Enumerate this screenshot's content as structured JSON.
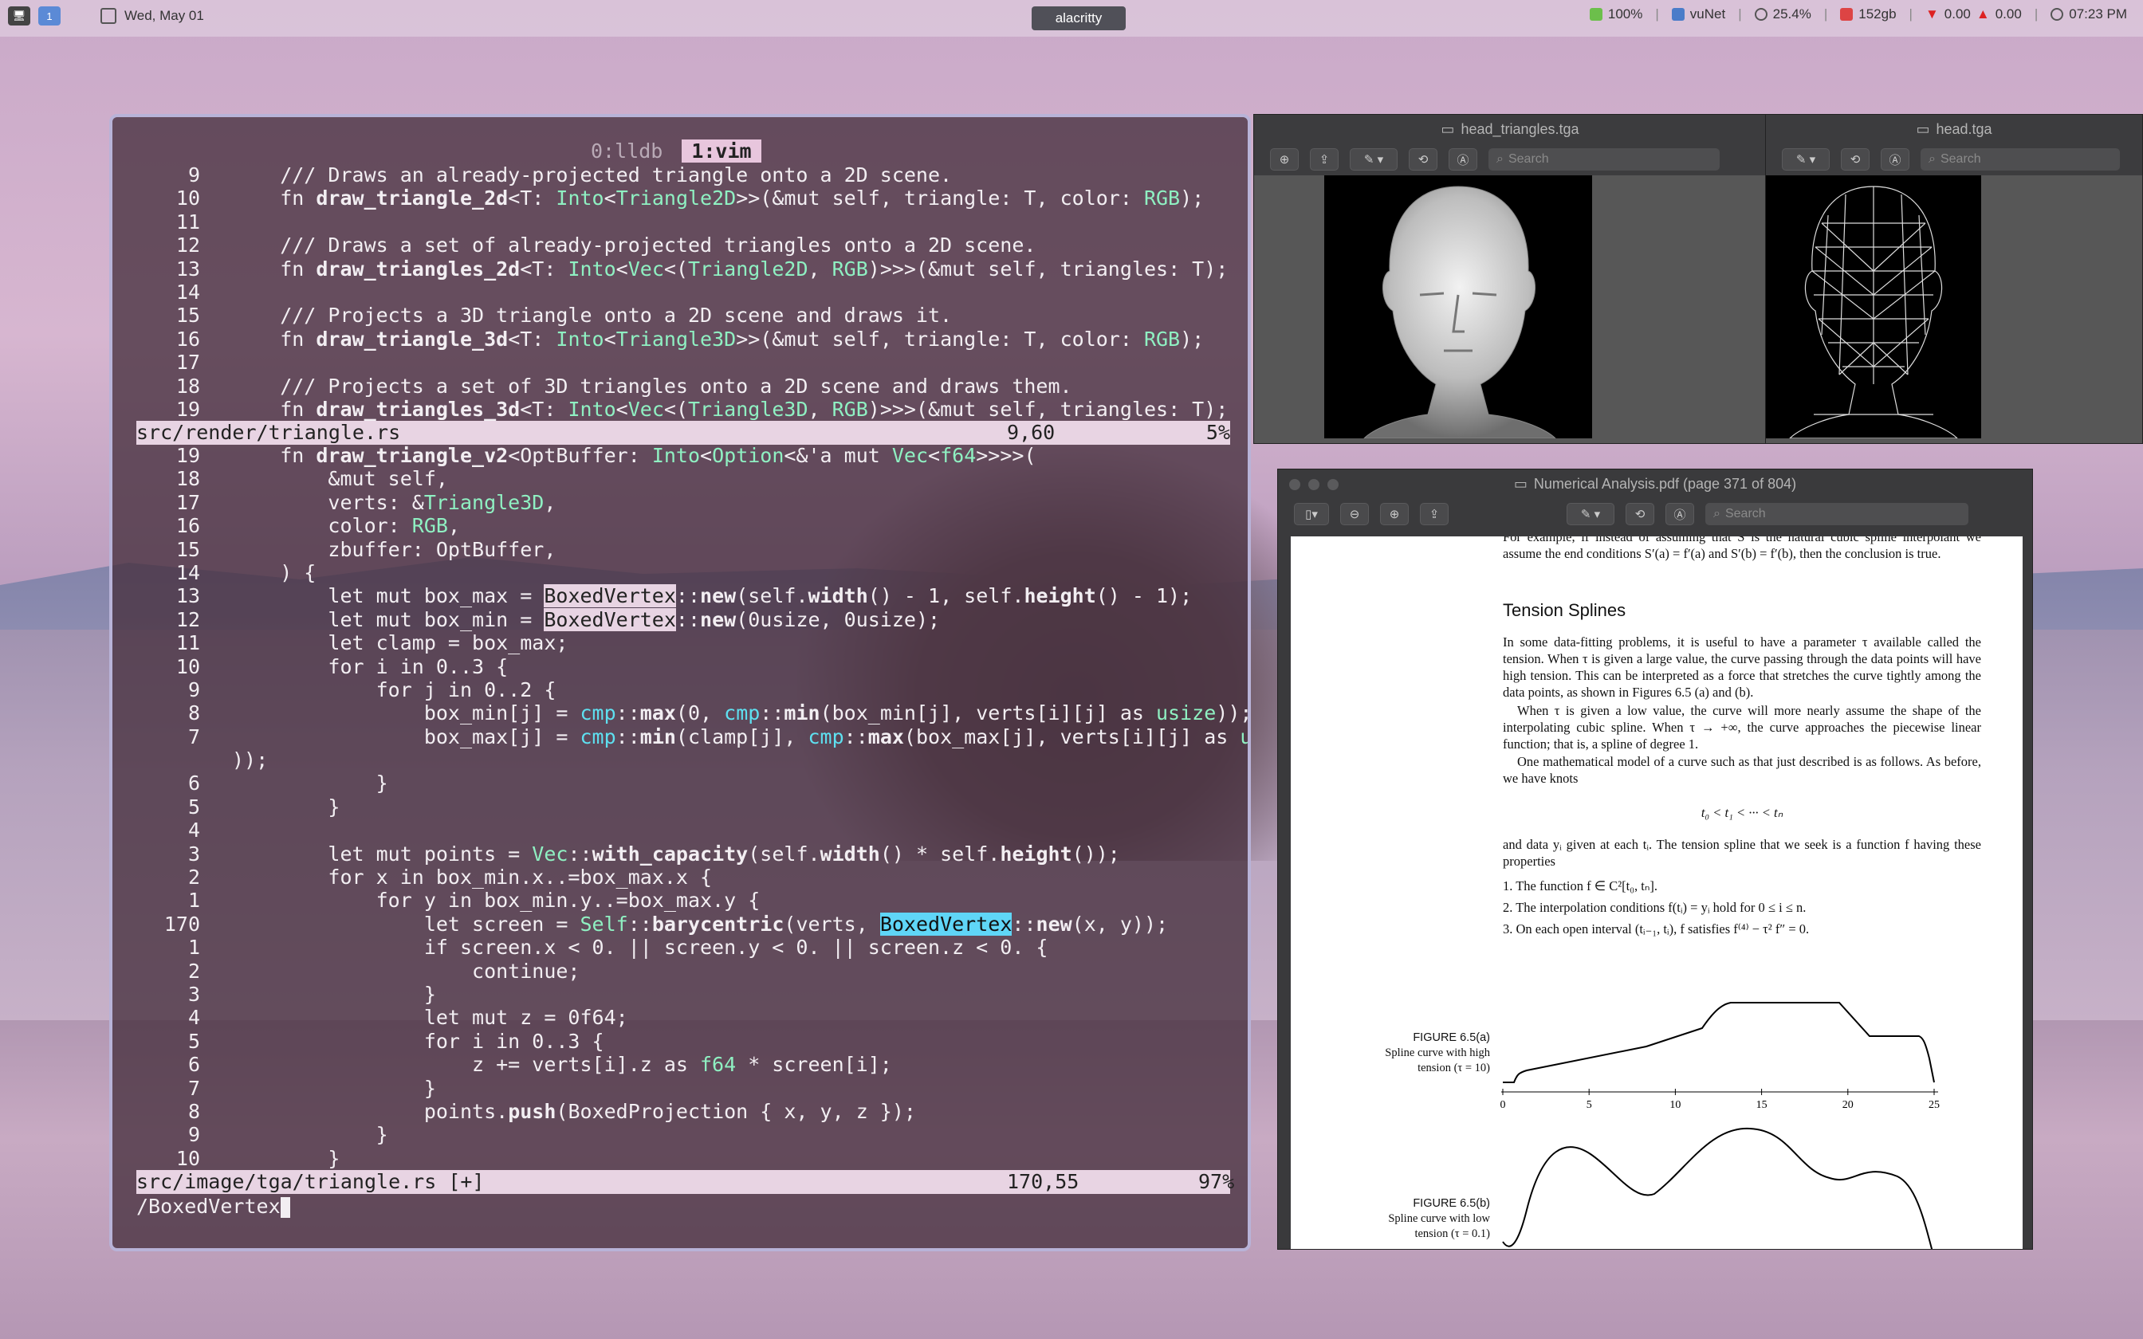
{
  "menubar": {
    "workspaces": [
      "🖥",
      "1"
    ],
    "date": "Wed, May 01",
    "active_app": "alacritty",
    "battery": "100%",
    "network": "vuNet",
    "cpu": "25.4%",
    "memory": "152gb",
    "net_down": "0.00",
    "net_up": "0.00",
    "time": "07:23 PM"
  },
  "terminal": {
    "tabs": [
      "0:lldb",
      "1:vim"
    ],
    "top_pane": {
      "lines": [
        {
          "n": "9",
          "t": "    /// Draws an already-projected triangle onto a 2D scene."
        },
        {
          "n": "10",
          "t": "    fn draw_triangle_2d<T: Into<Triangle2D>>(&mut self, triangle: T, color: RGB);"
        },
        {
          "n": "11",
          "t": ""
        },
        {
          "n": "12",
          "t": "    /// Draws a set of already-projected triangles onto a 2D scene."
        },
        {
          "n": "13",
          "t": "    fn draw_triangles_2d<T: Into<Vec<(Triangle2D, RGB)>>>(&mut self, triangles: T);"
        },
        {
          "n": "14",
          "t": ""
        },
        {
          "n": "15",
          "t": "    /// Projects a 3D triangle onto a 2D scene and draws it."
        },
        {
          "n": "16",
          "t": "    fn draw_triangle_3d<T: Into<Triangle3D>>(&mut self, triangle: T, color: RGB);"
        },
        {
          "n": "17",
          "t": ""
        },
        {
          "n": "18",
          "t": "    /// Projects a set of 3D triangles onto a 2D scene and draws them."
        },
        {
          "n": "19",
          "t": "    fn draw_triangles_3d<T: Into<Vec<(Triangle3D, RGB)>>>(&mut self, triangles: T);"
        }
      ],
      "status_file": "src/render/triangle.rs",
      "status_pos": "9,60",
      "status_pct": "5%"
    },
    "bottom_pane": {
      "lines": [
        {
          "n": "19",
          "t": "    fn draw_triangle_v2<OptBuffer: Into<Option<&'a mut Vec<f64>>>>("
        },
        {
          "n": "18",
          "t": "        &mut self,"
        },
        {
          "n": "17",
          "t": "        verts: &Triangle3D,"
        },
        {
          "n": "16",
          "t": "        color: RGB,"
        },
        {
          "n": "15",
          "t": "        zbuffer: OptBuffer,"
        },
        {
          "n": "14",
          "t": "    ) {"
        },
        {
          "n": "13",
          "t": "        let mut box_max = BoxedVertex::new(self.width() - 1, self.height() - 1);"
        },
        {
          "n": "12",
          "t": "        let mut box_min = BoxedVertex::new(0usize, 0usize);"
        },
        {
          "n": "11",
          "t": "        let clamp = box_max;"
        },
        {
          "n": "10",
          "t": "        for i in 0..3 {"
        },
        {
          "n": "9",
          "t": "            for j in 0..2 {"
        },
        {
          "n": "8",
          "t": "                box_min[j] = cmp::max(0, cmp::min(box_min[j], verts[i][j] as usize));"
        },
        {
          "n": "7",
          "t": "                box_max[j] = cmp::min(clamp[j], cmp::max(box_max[j], verts[i][j] as usize"
        },
        {
          "n": "",
          "t": "));"
        },
        {
          "n": "6",
          "t": "            }"
        },
        {
          "n": "5",
          "t": "        }"
        },
        {
          "n": "4",
          "t": ""
        },
        {
          "n": "3",
          "t": "        let mut points = Vec::with_capacity(self.width() * self.height());"
        },
        {
          "n": "2",
          "t": "        for x in box_min.x..=box_max.x {"
        },
        {
          "n": "1",
          "t": "            for y in box_min.y..=box_max.y {"
        },
        {
          "n": "170",
          "t": "                let screen = Self::barycentric(verts, BoxedVertex::new(x, y));"
        },
        {
          "n": "1",
          "t": "                if screen.x < 0. || screen.y < 0. || screen.z < 0. {"
        },
        {
          "n": "2",
          "t": "                    continue;"
        },
        {
          "n": "3",
          "t": "                }"
        },
        {
          "n": "4",
          "t": "                let mut z = 0f64;"
        },
        {
          "n": "5",
          "t": "                for i in 0..3 {"
        },
        {
          "n": "6",
          "t": "                    z += verts[i].z as f64 * screen[i];"
        },
        {
          "n": "7",
          "t": "                }"
        },
        {
          "n": "8",
          "t": "                points.push(BoxedProjection { x, y, z });"
        },
        {
          "n": "9",
          "t": "            }"
        },
        {
          "n": "10",
          "t": "        }"
        }
      ],
      "status_file": "src/image/tga/triangle.rs [+]",
      "status_pos": "170,55",
      "status_pct": "97%"
    },
    "command_line": "/BoxedVertex"
  },
  "preview1": {
    "title": "head_triangles.tga",
    "search_placeholder": "Search"
  },
  "preview2": {
    "title": "head.tga",
    "search_placeholder": "Search"
  },
  "pdf": {
    "title": "Numerical Analysis.pdf (page 371 of 804)",
    "search_placeholder": "Search",
    "intro": "For example, if instead of assuming that S is the natural cubic spline interpolant we assume the end conditions S′(a) = f′(a) and S′(b) = f′(b), then the conclusion is true.",
    "heading": "Tension Splines",
    "p1": "In some data-fitting problems, it is useful to have a parameter τ available called the tension. When τ is given a large value, the curve passing through the data points will have high tension. This can be interpreted as a force that stretches the curve tightly among the data points, as shown in Figures 6.5 (a) and (b).",
    "p2": "When τ is given a low value, the curve will more nearly assume the shape of the interpolating cubic spline. When τ → +∞, the curve approaches the piecewise linear function; that is, a spline of degree 1.",
    "p3": "One mathematical model of a curve such as that just described is as follows. As before, we have knots",
    "eq1": "t₀ < t₁ < ··· < tₙ",
    "p4": "and data yᵢ given at each tᵢ. The tension spline that we seek is a function f having these properties",
    "items": [
      "1.  The function f ∈ C²[t₀, tₙ].",
      "2.  The interpolation conditions f(tᵢ) = yᵢ hold for 0 ≤ i ≤ n.",
      "3.  On each open interval (tᵢ₋₁, tᵢ), f satisfies f⁽⁴⁾ − τ² f″ = 0."
    ],
    "fig_a": {
      "label": "FIGURE 6.5(a)",
      "caption1": "Spline curve with high",
      "caption2": "tension (τ = 10)"
    },
    "fig_b": {
      "label": "FIGURE 6.5(b)",
      "caption1": "Spline curve with low",
      "caption2": "tension (τ = 0.1)"
    },
    "axis_ticks": [
      "0",
      "5",
      "10",
      "15",
      "20",
      "25"
    ]
  }
}
